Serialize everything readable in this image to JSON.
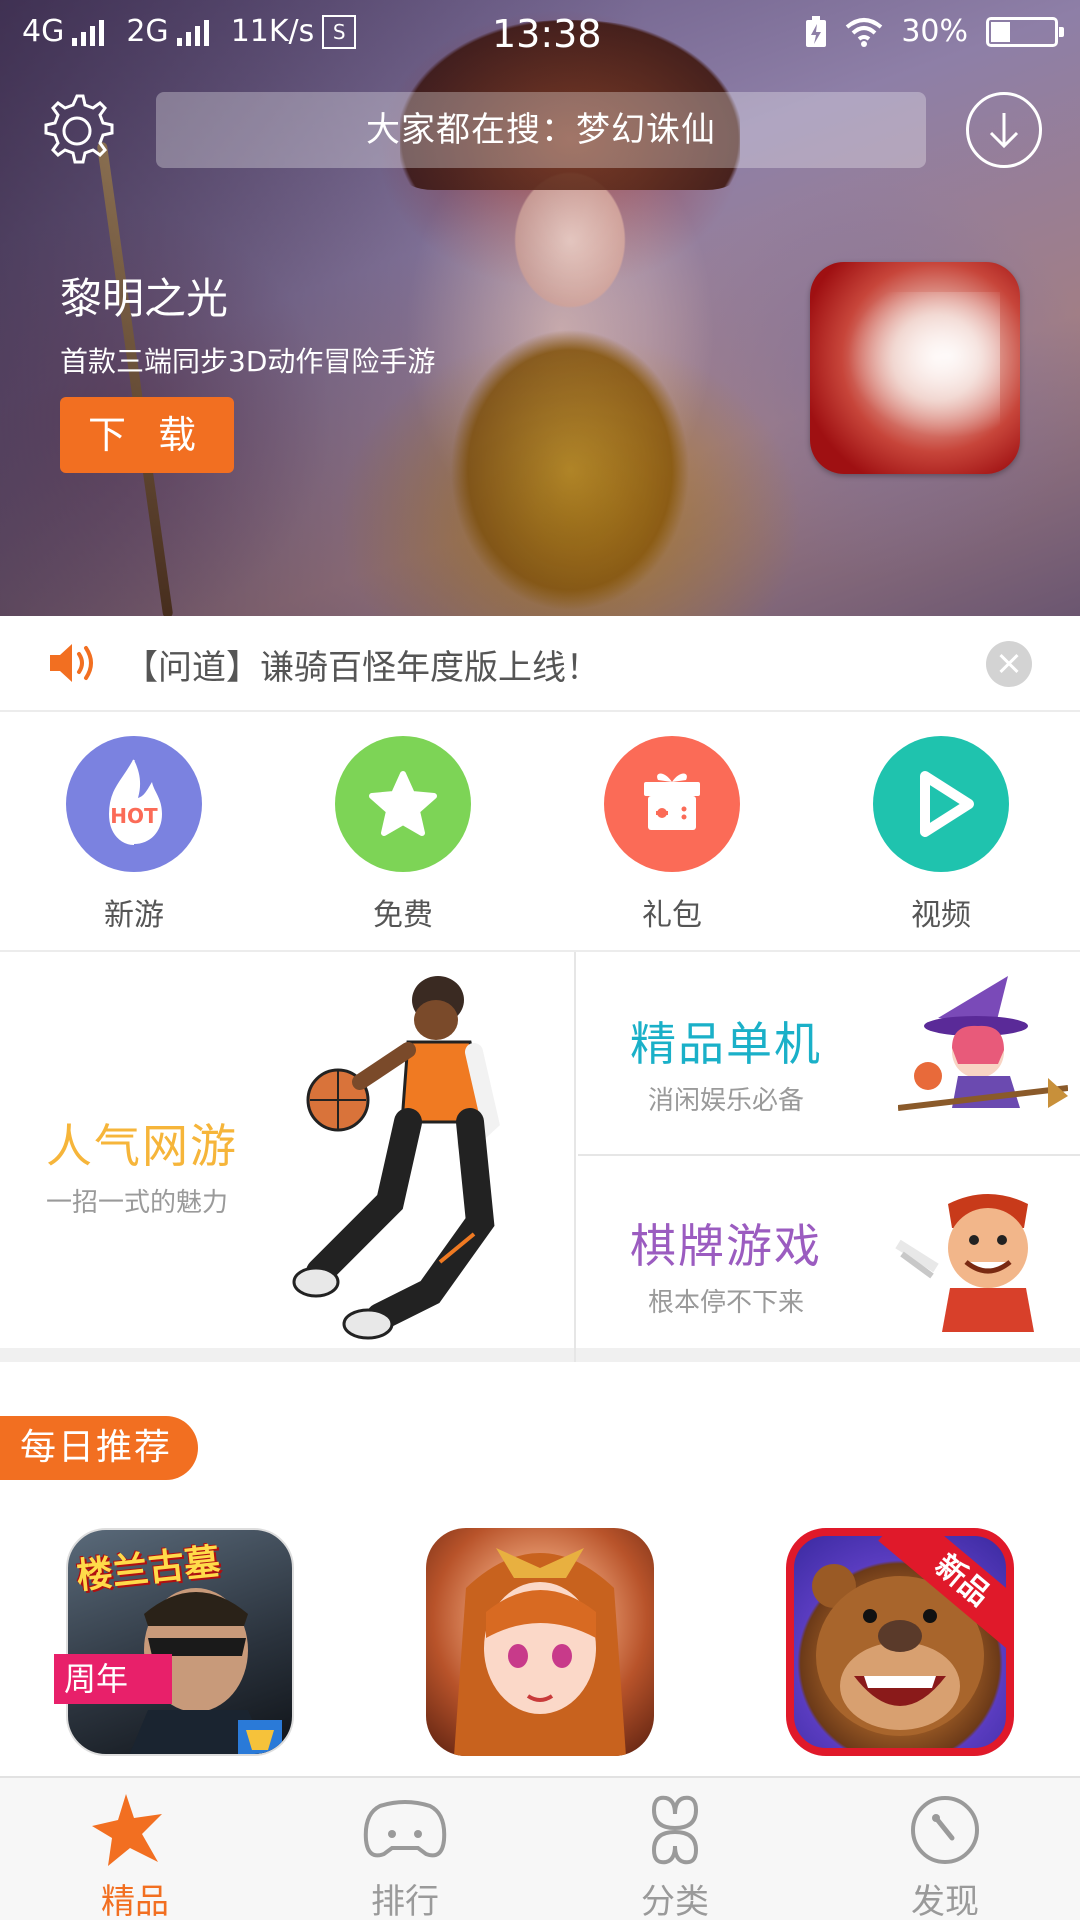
{
  "status_bar": {
    "network1": "4G",
    "network2": "2G",
    "speed": "11K/s",
    "sim_label": "S",
    "time": "13:38",
    "battery": "30%",
    "battery_level": 0.3
  },
  "header": {
    "search_placeholder": "大家都在搜：梦幻诛仙"
  },
  "banner": {
    "title": "黎明之光",
    "subtitle": "首款三端同步3D动作冒险手游",
    "download_label": "下 载"
  },
  "notice": {
    "text": "【问道】谦骑百怪年度版上线！"
  },
  "categories": [
    {
      "label": "新游",
      "icon": "hot-flame-icon",
      "color": "#7b82e0",
      "badge": "HOT"
    },
    {
      "label": "免费",
      "icon": "star-icon",
      "color": "#7dd456"
    },
    {
      "label": "礼包",
      "icon": "gift-icon",
      "color": "#fb6b57"
    },
    {
      "label": "视频",
      "icon": "play-icon",
      "color": "#1fc3ae"
    }
  ],
  "features": {
    "online": {
      "title": "人气网游",
      "subtitle": "一招一式的魅力",
      "color": "#f6b53a"
    },
    "single": {
      "title": "精品单机",
      "subtitle": "消闲娱乐必备",
      "color": "#1ab0c8"
    },
    "board": {
      "title": "棋牌游戏",
      "subtitle": "根本停不下来",
      "color": "#9b5cc0"
    }
  },
  "daily": {
    "label": "每日推荐",
    "apps": [
      {
        "icon_title": "楼兰古墓",
        "badge": "周年"
      },
      {},
      {
        "badge": "新品"
      }
    ]
  },
  "bottom_nav": [
    {
      "label": "精品",
      "icon": "star-splash-icon",
      "active": true
    },
    {
      "label": "排行",
      "icon": "gamepad-icon",
      "active": false
    },
    {
      "label": "分类",
      "icon": "clover-icon",
      "active": false
    },
    {
      "label": "发现",
      "icon": "compass-icon",
      "active": false
    }
  ],
  "colors": {
    "accent": "#f26f21"
  }
}
